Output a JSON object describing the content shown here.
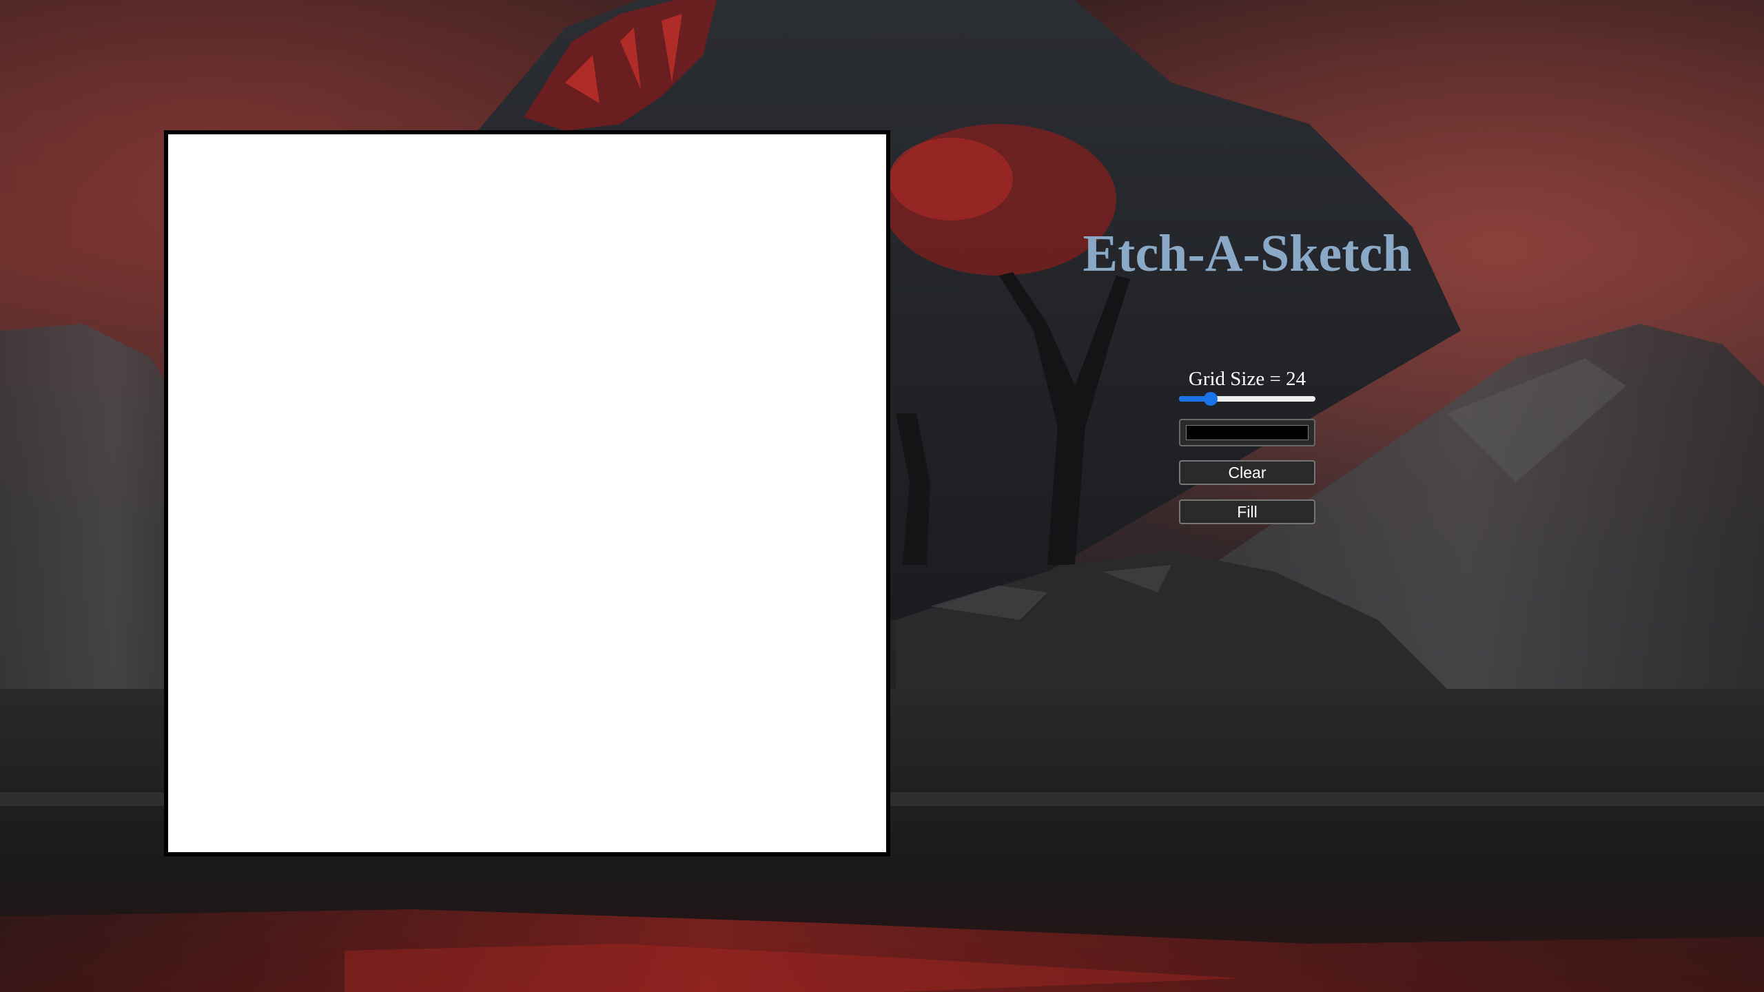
{
  "title": "Etch-A-Sketch",
  "grid": {
    "size": 24,
    "size_label": "Grid Size = 24",
    "min": 1,
    "max": 100,
    "cell_color": "#ffffff",
    "board_border_color": "#000000"
  },
  "color_picker": {
    "value": "#000000"
  },
  "buttons": {
    "clear_label": "Clear",
    "fill_label": "Fill"
  },
  "colors": {
    "title": "#8aa9c6",
    "accent": "#1a73e8",
    "label": "#ffffff"
  }
}
